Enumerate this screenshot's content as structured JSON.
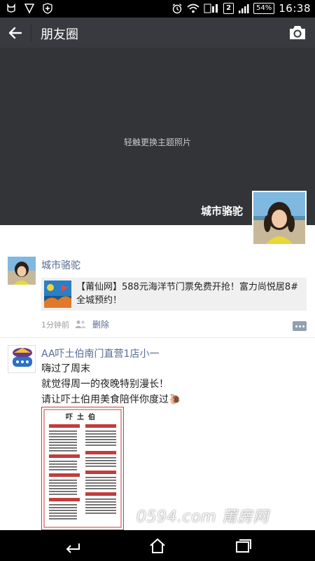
{
  "status_bar": {
    "time": "16:38",
    "battery": "54%",
    "sim": "2",
    "left_icons": [
      "cat-icon",
      "shield-icon",
      "shield-plus-icon"
    ],
    "right_icons": [
      "alarm-icon",
      "wifi-icon",
      "data-icon",
      "signal-icon",
      "battery-icon"
    ]
  },
  "header": {
    "title": "朋友圈",
    "back_icon": "arrow-left-icon",
    "camera_icon": "camera-icon"
  },
  "cover": {
    "hint": "轻触更换主题照片",
    "owner_name": "城市骆驼"
  },
  "posts": [
    {
      "author": "城市骆驼",
      "share_card": {
        "text": "【莆仙网】588元海洋节门票免费开抢！富力尚悦居8#全城预约！"
      },
      "time": "1分钟前",
      "delete_label": "删除"
    },
    {
      "author": "AA吓土伯南门直营1店小一",
      "lines": [
        "嗨过了周末",
        "就觉得周一的夜晚特别漫长！",
        "请让吓土伯用美食陪伴你度过"
      ],
      "avatar_text": "吓土伯",
      "image_title": "吓土伯"
    }
  ],
  "watermark": "0594.com 莆房网",
  "colors": {
    "topbar": "#393a3f",
    "cover": "#333438",
    "link": "#576b95",
    "menu_red": "#c23c3c"
  }
}
